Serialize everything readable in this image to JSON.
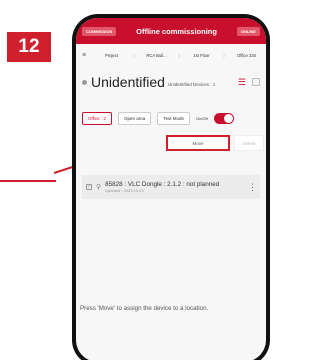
{
  "step_number": "12",
  "topbar": {
    "left_pill": "COMMISSION",
    "title": "Offline commissioning",
    "right_pill": "ONLINE"
  },
  "breadcrumb": [
    "Project",
    "RCA Buil...",
    "1st Floor",
    "Office 334"
  ],
  "heading": {
    "title": "Unidentified",
    "subtitle": "Unidentified Devices : 1"
  },
  "filters": {
    "office": "Office : 2",
    "open_area": "Open area",
    "test_mode": "Test Mode",
    "onoff_label": "On/Off"
  },
  "actions": {
    "move": "Move",
    "other": "Delete"
  },
  "device": {
    "title": "85828 : VLC Dongle : 2.1.2 : not planned",
    "updated": "Updated : 2023.10.23"
  },
  "hint": "Press 'Move' to assign the device to a location.",
  "colors": {
    "accent": "#c8102e"
  }
}
